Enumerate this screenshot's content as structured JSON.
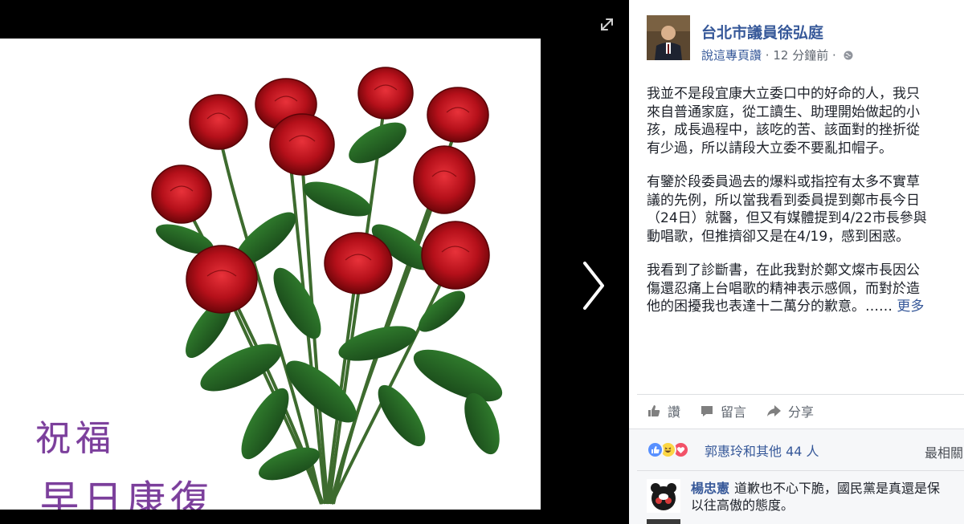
{
  "photo": {
    "caption_line1": "祝福",
    "caption_line2": "早日康復"
  },
  "viewer": {
    "expand_icon": "expand-arrows-icon",
    "next_icon": "chevron-right-icon"
  },
  "post": {
    "author": "台北市議員徐弘庭",
    "page_label": "說這專頁讚",
    "time": "12 分鐘前",
    "separator": "·",
    "audience_icon": "globe-icon",
    "paragraphs": [
      [
        "我並不是段宜康大立委口中的好命的人，我只",
        "來自普通家庭，從工讀生、助理開始做起的小",
        "孩，成長過程中，該吃的苦、該面對的挫折從",
        "有少過，所以請段大立委不要亂扣帽子。"
      ],
      [
        "有鑒於段委員過去的爆料或指控有太多不實草",
        "議的先例，所以當我看到委員提到鄭市長今日",
        "（24日）就醫，但又有媒體提到4/22市長參與",
        "動唱歌，但推擠卻又是在4/19，感到困惑。"
      ],
      [
        "我看到了診斷書，在此我對於鄭文燦市長因公",
        "傷還忍痛上台唱歌的精神表示感佩，而對於造",
        "他的困擾我也表達十二萬分的歉意。……"
      ]
    ],
    "see_more": "更多"
  },
  "actions": {
    "like": "讚",
    "comment": "留言",
    "share": "分享"
  },
  "stats": {
    "reactions_text": "郭惠玲和其他 44 人",
    "sort_label": "最相關",
    "reaction_icons": [
      "like-reaction-icon",
      "haha-reaction-icon",
      "love-reaction-icon"
    ]
  },
  "comment": {
    "author": "楊忠憲",
    "line1": "道歉也不心下脆，國民黨是真還是保",
    "line2": "以往高傲的態度。"
  },
  "colors": {
    "link": "#365899",
    "caption": "#7b3f9b",
    "rose": "#c0141d",
    "like_blue": "#5890ff",
    "love_red": "#f25268",
    "haha_yellow": "#fcd644"
  }
}
